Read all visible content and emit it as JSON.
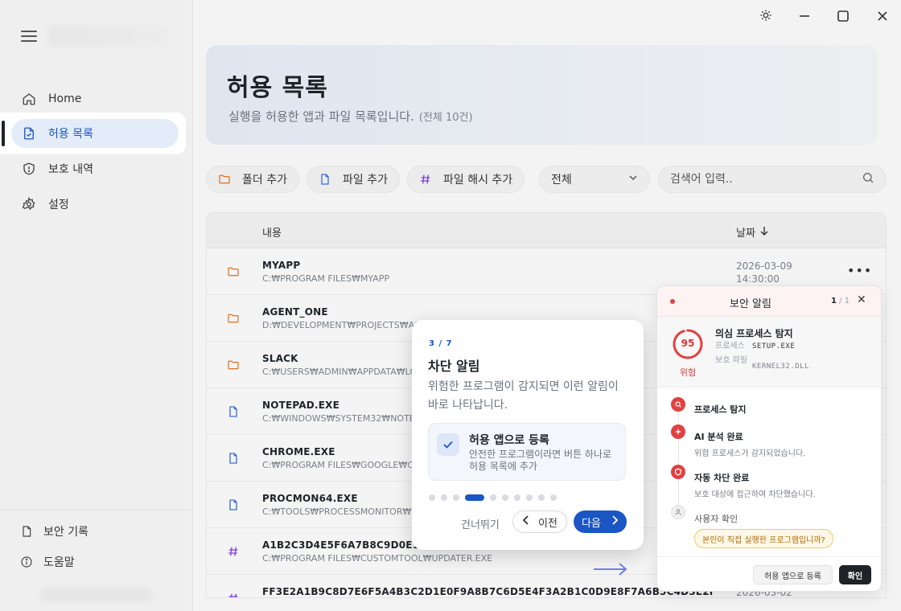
{
  "sidebar": {
    "items": [
      {
        "label": "Home"
      },
      {
        "label": "허용 목록"
      },
      {
        "label": "보호 내역"
      },
      {
        "label": "설정"
      }
    ],
    "bottom": [
      {
        "label": "보안 기록"
      },
      {
        "label": "도움말"
      }
    ]
  },
  "header": {
    "title": "허용 목록",
    "subtitle": "실행을 허용한 앱과 파일 목록입니다.",
    "count": "(전체 10건)"
  },
  "toolbar": {
    "add_folder": "폴더 추가",
    "add_file": "파일 추가",
    "add_hash": "파일 해시 추가",
    "filter_value": "전체",
    "search_placeholder": "검색어 입력.."
  },
  "table": {
    "col_content": "내용",
    "col_date": "날짜",
    "rows": [
      {
        "type": "folder",
        "name": "MYAPP",
        "path": "C:₩PROGRAM FILES₩MYAPP",
        "date": "2026-03-09",
        "time": "14:30:00"
      },
      {
        "type": "folder",
        "name": "AGENT_ONE",
        "path": "D:₩DEVELOPMENT₩PROJECTS₩AGENT_ONE",
        "date": "",
        "time": ""
      },
      {
        "type": "folder",
        "name": "SLACK",
        "path": "C:₩USERS₩ADMIN₩APPDATA₩LOCAL₩SLACK",
        "date": "",
        "time": ""
      },
      {
        "type": "file",
        "name": "NOTEPAD.EXE",
        "path": "C:₩WINDOWS₩SYSTEM32₩NOTEPAD.EXE",
        "date": "",
        "time": ""
      },
      {
        "type": "file",
        "name": "CHROME.EXE",
        "path": "C:₩PROGRAM FILES₩GOOGLE₩CHROME₩APPLICATION",
        "date": "",
        "time": ""
      },
      {
        "type": "file",
        "name": "PROCMON64.EXE",
        "path": "C:₩TOOLS₩PROCESSMONITOR₩PROCMON64.EXE",
        "date": "",
        "time": ""
      },
      {
        "type": "hash",
        "name": "A1B2C3D4E5F6A7B8C9D0E1F2A3B4C5D6",
        "path": "C:₩PROGRAM FILES₩CUSTOMTOOL₩UPDATER.EXE",
        "date": "",
        "time": ""
      },
      {
        "type": "hash",
        "name": "FF3E2A1B9C8D7E6F5A4B3C2D1E0F9A8B7C6D5E4F3A2B1C0D9E8F7A6B5C4D3E2F",
        "path": "",
        "date": "2026-03-02",
        "time": ""
      }
    ]
  },
  "coach": {
    "step": "3 / 7",
    "title": "차단 알림",
    "desc": "위험한 프로그램이 감지되면 이런 알림이 바로 나타납니다.",
    "card_title": "허용 앱으로 등록",
    "card_desc": "안전한 프로그램이라면 버튼 하나로 허용 목록에 추가",
    "skip": "건너뛰기",
    "prev": "이전",
    "next": "다음",
    "dots_total": 10,
    "dots_active": 3
  },
  "alert": {
    "title": "보안 알림",
    "page_current": "1",
    "page_sep": "/ 1",
    "score": "95",
    "risk_label": "위험",
    "threat_title": "의심 프로세스 탐지",
    "process_key": "프로세스",
    "process_val": "SETUP.EXE",
    "protected_key": "보호 파일",
    "protected_val": "KERNEL32.DLL",
    "timeline": [
      {
        "title": "프로세스 탐지",
        "desc": ""
      },
      {
        "title": "AI 분석 완료",
        "desc": "위협 프로세스가 감지되었습니다."
      },
      {
        "title": "자동 차단 완료",
        "desc": "보호 대상에 접근하여 차단했습니다."
      },
      {
        "title": "사용자 확인",
        "desc": ""
      }
    ],
    "question": "본인이 직접 실행한 프로그램입니까?",
    "register_btn": "허용 앱으로 등록",
    "confirm_btn": "확인"
  },
  "colors": {
    "accent": "#1a56c4",
    "danger": "#e24141",
    "folder": "#e07a2c",
    "file": "#3b6fd6",
    "hash": "#7a3fd6"
  }
}
